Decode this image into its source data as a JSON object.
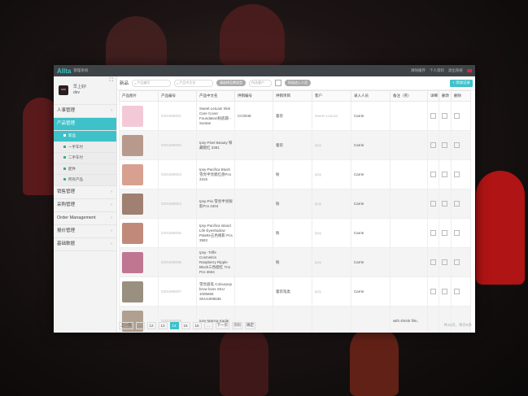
{
  "app": {
    "brand": "Allta",
    "subtitle": "管理系统",
    "top_links": [
      "清除缓存",
      "个人资料",
      "退出系统"
    ],
    "flag_icon": "flag-icon"
  },
  "user": {
    "name": "早上好!",
    "role": "dev"
  },
  "menu": [
    {
      "label": "人事管理",
      "active": false
    },
    {
      "label": "产品管理",
      "active": true,
      "sub": [
        {
          "label": "新品",
          "active": true
        },
        {
          "label": "一手车付",
          "active": false
        },
        {
          "label": "二手车付",
          "active": false
        },
        {
          "label": "配件",
          "active": false
        },
        {
          "label": "所有产品",
          "active": false
        }
      ]
    },
    {
      "label": "销售管理",
      "active": false
    },
    {
      "label": "采购管理",
      "active": false
    },
    {
      "label": "Order Management",
      "active": false
    },
    {
      "label": "报价管理",
      "active": false
    },
    {
      "label": "基础数据",
      "active": false
    }
  ],
  "toolbar": {
    "label": "新品",
    "search_code": "产品编号",
    "search_name": "产品中文名",
    "pill1": "请选择品牌类型",
    "search_customer": "所选客户",
    "pill2": "所选进入人员",
    "add_label": "+ 添加记录"
  },
  "columns": [
    "产品图片",
    "产品编号",
    "产品中文名",
    "供销编号",
    "供销项目",
    "客户",
    "录入人员",
    "备注（英）",
    "详细",
    "删改",
    "删除"
  ],
  "rows": [
    {
      "thumb": "#f3c9d8",
      "code": "0201908001",
      "name": "Sweet LeiLani Skin Care Cover Foundation粉底霜 -Suntan",
      "supp": "CC0048",
      "proj": "着装",
      "cust": "Sweet LeiLani",
      "staff": "Carrie",
      "note": ""
    },
    {
      "thumb": "#b89a8c",
      "code": "0201908002",
      "name": "Ipsy-Pixel Beauty 铁藏腮红 3381",
      "supp": "",
      "proj": "着装",
      "cust": "ipsy",
      "staff": "Carrie",
      "note": ""
    },
    {
      "thumb": "#d8a090",
      "code": "0201908003",
      "name": "Ipsy-Pacifica Blush 雪亮半亮腮红盘Pcs 3315",
      "supp": "",
      "proj": "粉",
      "cust": "ipsy",
      "staff": "Carrie",
      "note": ""
    },
    {
      "thumb": "#a08070",
      "code": "0201908004",
      "name": "Ipsy-Pixi 雪亮半亮眼影Pcs 3404",
      "supp": "",
      "proj": "粉",
      "cust": "ipsy",
      "staff": "Carrie",
      "note": ""
    },
    {
      "thumb": "#c08a7a",
      "code": "0201908005",
      "name": "Ipsy-Pacifica Island Life Eyeshadow Palette五色眼影 Pcs 3583",
      "supp": "",
      "proj": "粉",
      "cust": "ipsy",
      "staff": "Carrie",
      "note": ""
    },
    {
      "thumb": "#c07590",
      "code": "0201908006",
      "name": "Ipsy- Triffe Cosmetics Raspberry Ripple Blush三色腮红 Trio Pcs 3604",
      "supp": "",
      "proj": "粉",
      "cust": "ipsy",
      "staff": "Carrie",
      "note": ""
    },
    {
      "thumb": "#9a9080",
      "code": "0201908007",
      "name": "雪亮眉笔 Colourpop brow boss SKU 1005656 SKU1005635",
      "supp": "",
      "proj": "着装笔类",
      "cust": "ipsy",
      "staff": "Carrie",
      "note": ""
    },
    {
      "thumb": "#b0a090",
      "code": "0201908008",
      "name": "Ipsy-Manna Kadar",
      "supp": "",
      "proj": "",
      "cust": "",
      "staff": "",
      "note": "with shrink film,"
    }
  ],
  "pager": {
    "prev": "上一页",
    "pages": [
      "…",
      "12",
      "13",
      "14",
      "15",
      "16",
      "…"
    ],
    "current": "14",
    "next": "下一页",
    "goto_label": "页码",
    "go": "确定",
    "info": "共15页，每页8条"
  },
  "colors": {
    "accent": "#3fc1c9",
    "topbar": "#3e4347"
  }
}
